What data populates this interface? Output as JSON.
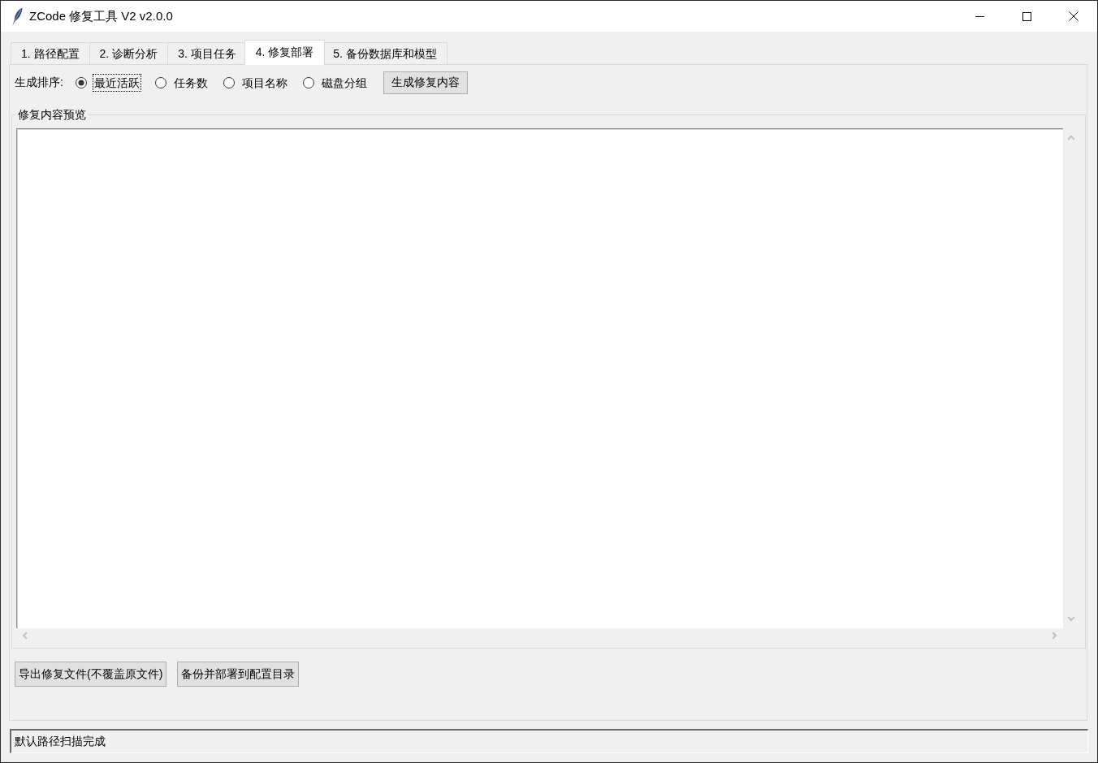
{
  "window": {
    "title": "ZCode 修复工具 V2 v2.0.0"
  },
  "tabs": [
    {
      "label": "1. 路径配置",
      "selected": false
    },
    {
      "label": "2. 诊断分析",
      "selected": false
    },
    {
      "label": "3. 项目任务",
      "selected": false
    },
    {
      "label": "4. 修复部署",
      "selected": true
    },
    {
      "label": "5. 备份数据库和模型",
      "selected": false
    }
  ],
  "sort": {
    "label": "生成排序:",
    "options": [
      {
        "label": "最近活跃",
        "selected": true,
        "focused": true
      },
      {
        "label": "任务数",
        "selected": false,
        "focused": false
      },
      {
        "label": "项目名称",
        "selected": false,
        "focused": false
      },
      {
        "label": "磁盘分组",
        "selected": false,
        "focused": false
      }
    ],
    "button": "生成修复内容"
  },
  "preview": {
    "title": "修复内容预览"
  },
  "actions": [
    "导出修复文件(不覆盖原文件)",
    "备份并部署到配置目录"
  ],
  "status_bar": {
    "text": "默认路径扫描完成"
  }
}
